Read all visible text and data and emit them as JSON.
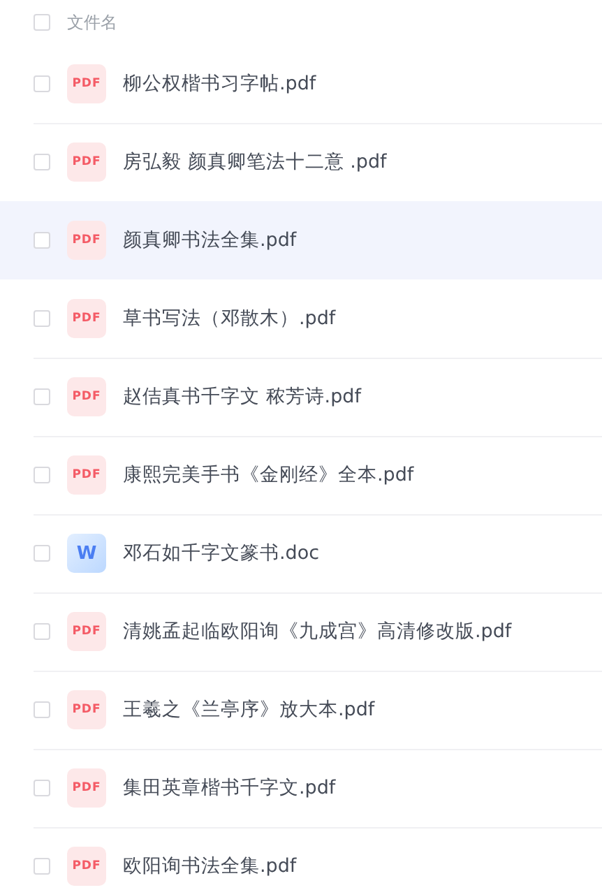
{
  "header": {
    "checked": false,
    "label": "文件名"
  },
  "files": [
    {
      "name": "柳公权楷书习字帖.pdf",
      "kind": "pdf",
      "badge": "PDF",
      "checked": false,
      "highlighted": false
    },
    {
      "name": "房弘毅 颜真卿笔法十二意 .pdf",
      "kind": "pdf",
      "badge": "PDF",
      "checked": false,
      "highlighted": false
    },
    {
      "name": "颜真卿书法全集.pdf",
      "kind": "pdf",
      "badge": "PDF",
      "checked": false,
      "highlighted": true
    },
    {
      "name": "草书写法（邓散木）.pdf",
      "kind": "pdf",
      "badge": "PDF",
      "checked": false,
      "highlighted": false
    },
    {
      "name": "赵佶真书千字文 秾芳诗.pdf",
      "kind": "pdf",
      "badge": "PDF",
      "checked": false,
      "highlighted": false
    },
    {
      "name": "康熙完美手书《金刚经》全本.pdf",
      "kind": "pdf",
      "badge": "PDF",
      "checked": false,
      "highlighted": false
    },
    {
      "name": "邓石如千字文篆书.doc",
      "kind": "word",
      "badge": "W",
      "checked": false,
      "highlighted": false
    },
    {
      "name": "清姚孟起临欧阳询《九成宫》高清修改版.pdf",
      "kind": "pdf",
      "badge": "PDF",
      "checked": false,
      "highlighted": false
    },
    {
      "name": "王羲之《兰亭序》放大本.pdf",
      "kind": "pdf",
      "badge": "PDF",
      "checked": false,
      "highlighted": false
    },
    {
      "name": "集田英章楷书千字文.pdf",
      "kind": "pdf",
      "badge": "PDF",
      "checked": false,
      "highlighted": false
    },
    {
      "name": "欧阳询书法全集.pdf",
      "kind": "pdf",
      "badge": "PDF",
      "checked": false,
      "highlighted": false
    }
  ]
}
